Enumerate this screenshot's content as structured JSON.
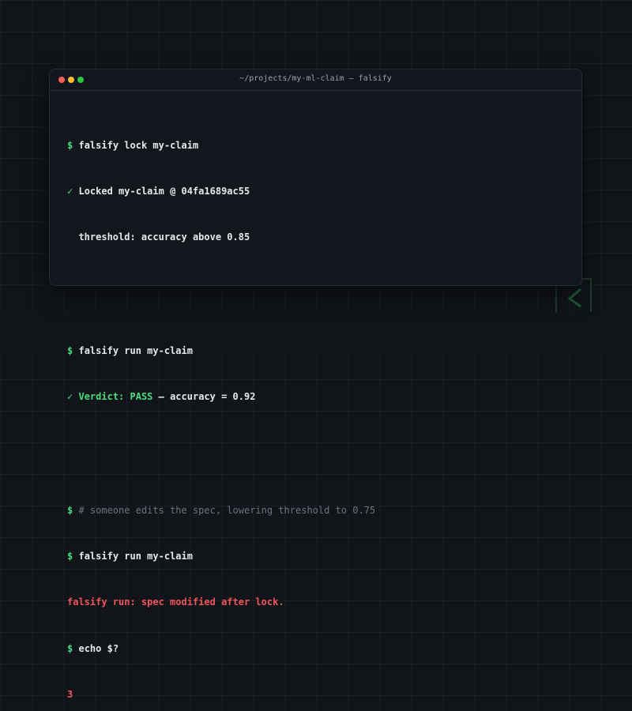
{
  "window": {
    "title": "~/projects/my-ml-claim — falsify"
  },
  "terminal": {
    "prompt_symbol": "$",
    "check_symbol": "✓",
    "lock_cmd": "falsify lock my-claim",
    "locked_msg": "Locked my-claim @ 04fa1689ac55",
    "threshold_msg": "threshold: accuracy above 0.85",
    "run_cmd_1": "falsify run my-claim",
    "verdict_label": "Verdict: PASS",
    "verdict_rest": " — accuracy = 0.92",
    "comment": "# someone edits the spec, lowering threshold to 0.75",
    "run_cmd_2": "falsify run my-claim",
    "error_msg": "falsify run: spec modified after lock.",
    "echo_cmd": "echo $?",
    "exit_code": "3"
  },
  "colors": {
    "accent_green": "#4ade80",
    "error_red": "#f2555a",
    "comment_gray": "#6b7480"
  }
}
